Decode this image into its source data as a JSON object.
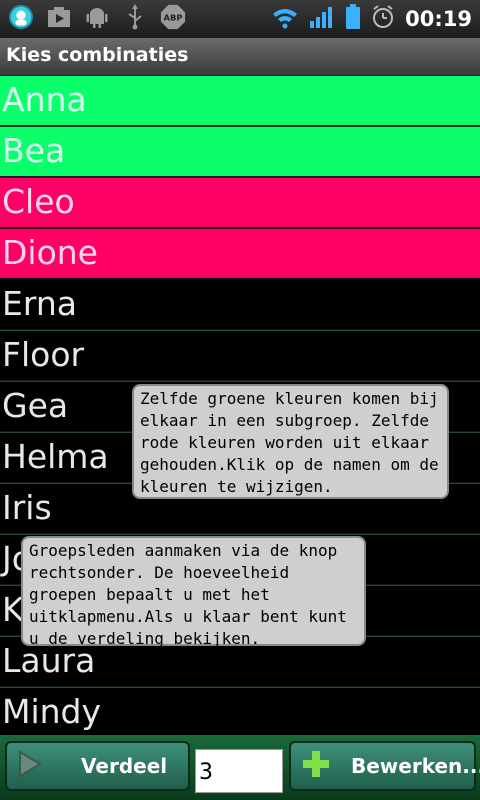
{
  "status": {
    "time": "00:19",
    "abp_label": "ABP"
  },
  "title": "Kies combinaties",
  "names": [
    {
      "label": "Anna",
      "color": "green"
    },
    {
      "label": "Bea",
      "color": "green"
    },
    {
      "label": "Cleo",
      "color": "red"
    },
    {
      "label": "Dione",
      "color": "red"
    },
    {
      "label": "Erna",
      "color": "plain"
    },
    {
      "label": "Floor",
      "color": "plain"
    },
    {
      "label": "Gea",
      "color": "plain"
    },
    {
      "label": "Helma",
      "color": "plain"
    },
    {
      "label": "Iris",
      "color": "plain"
    },
    {
      "label": "Jo",
      "color": "plain"
    },
    {
      "label": "K",
      "color": "plain"
    },
    {
      "label": "Laura",
      "color": "plain"
    },
    {
      "label": "Mindy",
      "color": "plain"
    }
  ],
  "colors": {
    "green": "#0bff6b",
    "red": "#ff0066",
    "background": "#000000"
  },
  "tooltips": {
    "tip1": "Zelfde groene kleuren komen bij elkaar in een subgroep. Zelfde rode kleuren worden uit elkaar gehouden.Klik op de namen om de kleuren te wijzigen.",
    "tip2": "Groepsleden aanmaken via de knop rechtsonder. De hoeveelheid groepen bepaalt u met het uitklapmenu.Als u klaar bent kunt u de verdeling bekijken."
  },
  "bottom": {
    "verdeel_label": "Verdeel",
    "groups_value": "3",
    "bewerken_label": "Bewerken..."
  }
}
